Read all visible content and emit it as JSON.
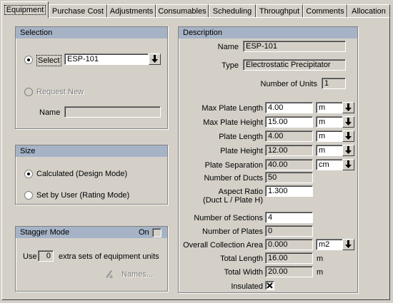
{
  "tabs": [
    "Equipment",
    "Purchase Cost",
    "Adjustments",
    "Consumables",
    "Scheduling",
    "Throughput",
    "Comments",
    "Allocation"
  ],
  "selection": {
    "title": "Selection",
    "select_label": "Select",
    "select_value": "ESP-101",
    "request_new_label": "Request New",
    "name_label": "Name",
    "name_value": ""
  },
  "size": {
    "title": "Size",
    "calculated_label": "Calculated (Design Mode)",
    "user_label": "Set by User (Rating Mode)"
  },
  "stagger": {
    "title": "Stagger Mode",
    "on_label": "On",
    "use_label": "Use",
    "use_value": "0",
    "extra_label": "extra sets of equipment units",
    "names_label": "Names..."
  },
  "description": {
    "title": "Description",
    "name_label": "Name",
    "name_value": "ESP-101",
    "type_label": "Type",
    "type_value": "Electrostatic Precipitator",
    "units_label": "Number of Units",
    "units_value": "1",
    "max_plate_length_label": "Max Plate Length",
    "max_plate_length_value": "4.00",
    "max_plate_length_unit": "m",
    "max_plate_height_label": "Max Plate Height",
    "max_plate_height_value": "15.00",
    "max_plate_height_unit": "m",
    "plate_length_label": "Plate Length",
    "plate_length_value": "4.00",
    "plate_length_unit": "m",
    "plate_height_label": "Plate Height",
    "plate_height_value": "12.00",
    "plate_height_unit": "m",
    "plate_sep_label": "Plate Separation",
    "plate_sep_value": "40.00",
    "plate_sep_unit": "cm",
    "ducts_label": "Number of Ducts",
    "ducts_value": "50",
    "aspect_label_1": "Aspect Ratio",
    "aspect_label_2": "(Duct L / Plate H)",
    "aspect_value": "1.300",
    "sections_label": "Number of Sections",
    "sections_value": "4",
    "plates_label": "Number of Plates",
    "plates_value": "0",
    "area_label": "Overall Collection Area",
    "area_value": "0.000",
    "area_unit": "m2",
    "total_length_label": "Total Length",
    "total_length_value": "16.00",
    "total_length_unit": "m",
    "total_width_label": "Total Width",
    "total_width_value": "20.00",
    "total_width_unit": "m",
    "insulated_label": "Insulated"
  }
}
